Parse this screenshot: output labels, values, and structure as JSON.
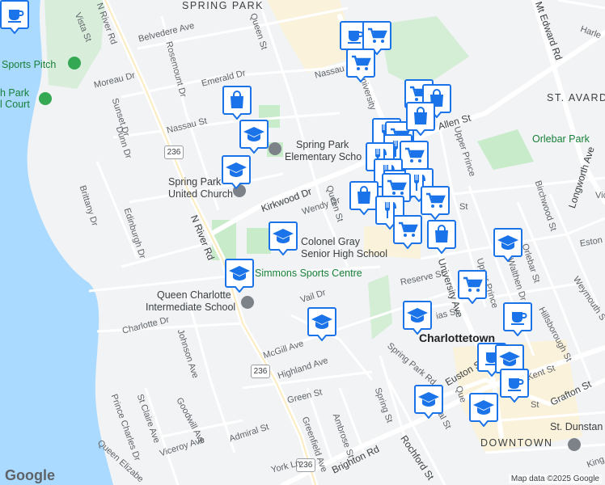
{
  "areas": {
    "spring_park": "SPRING PARK",
    "st_avard": "ST. AVARD",
    "downtown": "DOWNTOWN",
    "charlottetown": "Charlottetown"
  },
  "pois": {
    "sports_pitch": "Sports Pitch",
    "north_park_court_line1": "h Park",
    "north_park_court_line2": "l Court",
    "spring_park_school_line1": "Spring Park",
    "spring_park_school_line2": "Elementary Scho",
    "spring_park_church_line1": "Spring Park",
    "spring_park_church_line2": "United Church",
    "colonel_gray_line1": "Colonel Gray",
    "colonel_gray_line2": "Senior High School",
    "simmons": "Simmons Sports Centre",
    "queen_charlotte_line1": "Queen Charlotte",
    "queen_charlotte_line2": "Intermediate School",
    "orlebar_park": "Orlebar Park",
    "st_dunstan": "St. Dunstan"
  },
  "streets": {
    "n_river_rd_top": "N River Rd",
    "n_river_rd": "N River Rd",
    "vista": "Vista St",
    "belvedere": "Belvedere Ave",
    "queen_st_top": "Queen St",
    "rosemount": "Rosemount Dr",
    "emerald": "Emerald Dr",
    "nassau_top": "Nassau St",
    "nassau": "Nassau St",
    "moreau": "Moreau Dr",
    "sunset": "Sunset Dr",
    "dunn": "Dunn Dr",
    "university_top": "University",
    "allen": "Allen St",
    "upper_prince": "Upper Prince",
    "upper_prince_2": "Upper Prince",
    "kirkwood": "Kirkwood Dr",
    "brittany": "Brittany Dr",
    "edinburgh": "Edinburgh Dr",
    "wendy": "Wendy Dr",
    "queen_st_mid": "Queen St",
    "reserve": "Reserve St",
    "university_ave": "University Ave",
    "vail": "Vail Dr",
    "charlotte_dr": "Charlotte Dr",
    "johnson": "Johnson Ave",
    "mcgill": "McGill Ave",
    "highland": "Highland Ave",
    "spring_park_rd": "Spring Park Rd",
    "euston": "Euston St",
    "euston_right": "Euston St",
    "green": "Green St",
    "st_claire": "St Claire Ave",
    "goodwill": "Goodwill Ave",
    "prince_charles": "Prince Charles Dr",
    "admiral": "Admiral St",
    "viceroy": "Viceroy Ave",
    "greenfield": "Greenfield Ave",
    "ambrose": "Ambrose St",
    "spring_st": "Spring St",
    "rochford": "Rochford St",
    "brighton": "Brighton Rd",
    "york_ln": "York Ln",
    "queen_elizabeth": "Queen Elizabe",
    "kent": "Kent St",
    "grafton": "Grafton St",
    "walthen": "Walthen Dr",
    "birchwood": "Birchwood St",
    "orlebar": "Orlebar St",
    "hillsborough": "Hillsborough St",
    "weymouth": "Weymouth S",
    "longworth": "Longworth Ave",
    "mt_edward": "Mt Edward Rd",
    "harley": "Harle",
    "esto": "Eston St",
    "vi": "Vic",
    "ias": "ias St",
    "downl": "ownal St",
    "que": "Que",
    "king": "King",
    "street_s": "St",
    "elm": "St"
  },
  "route_shields": [
    "236",
    "236",
    "236",
    "236"
  ],
  "markers": [
    {
      "type": "cafe",
      "icon": "coffee-cup-icon"
    },
    {
      "type": "grocery",
      "icon": "shopping-cart-icon"
    },
    {
      "type": "grocery",
      "icon": "shopping-cart-icon"
    },
    {
      "type": "shopping",
      "icon": "shopping-bag-icon"
    },
    {
      "type": "school",
      "icon": "graduation-cap-icon"
    },
    {
      "type": "school",
      "icon": "graduation-cap-icon"
    },
    {
      "type": "restaurant",
      "icon": "fork-knife-icon"
    },
    {
      "type": "grocery",
      "icon": "shopping-cart-icon"
    },
    {
      "type": "shopping",
      "icon": "shopping-bag-icon"
    },
    {
      "type": "grocery",
      "icon": "shopping-cart-icon"
    },
    {
      "type": "shopping",
      "icon": "shopping-bag-icon"
    },
    {
      "type": "restaurant",
      "icon": "fork-knife-icon"
    },
    {
      "type": "restaurant",
      "icon": "fork-knife-icon"
    },
    {
      "type": "grocery",
      "icon": "shopping-cart-icon"
    },
    {
      "type": "restaurant",
      "icon": "fork-knife-icon"
    },
    {
      "type": "grocery",
      "icon": "shopping-cart-icon"
    },
    {
      "type": "restaurant",
      "icon": "fork-knife-icon"
    },
    {
      "type": "shopping",
      "icon": "shopping-bag-icon"
    },
    {
      "type": "grocery",
      "icon": "shopping-cart-icon"
    },
    {
      "type": "grocery",
      "icon": "shopping-cart-icon"
    },
    {
      "type": "restaurant",
      "icon": "fork-knife-icon"
    },
    {
      "type": "grocery",
      "icon": "shopping-cart-icon"
    },
    {
      "type": "shopping",
      "icon": "shopping-bag-icon"
    },
    {
      "type": "school",
      "icon": "graduation-cap-icon"
    },
    {
      "type": "school",
      "icon": "graduation-cap-icon"
    },
    {
      "type": "school",
      "icon": "graduation-cap-icon"
    },
    {
      "type": "grocery",
      "icon": "shopping-cart-icon"
    },
    {
      "type": "cafe",
      "icon": "coffee-cup-icon"
    },
    {
      "type": "school",
      "icon": "graduation-cap-icon"
    },
    {
      "type": "school",
      "icon": "graduation-cap-icon"
    },
    {
      "type": "cafe",
      "icon": "coffee-cup-icon"
    },
    {
      "type": "school",
      "icon": "graduation-cap-icon"
    },
    {
      "type": "cafe",
      "icon": "coffee-cup-icon"
    },
    {
      "type": "school",
      "icon": "graduation-cap-icon"
    },
    {
      "type": "school",
      "icon": "graduation-cap-icon"
    },
    {
      "type": "cafe",
      "icon": "coffee-cup-icon"
    }
  ],
  "colors": {
    "water": "#aadaff",
    "land": "#f1f3f4",
    "park": "#c8ebc9",
    "marker_fill": "#1a73e8",
    "marker_bg": "#ffffff",
    "commercial": "#fdf1d3"
  },
  "logo": "Google",
  "attribution": "Map data ©2025 Google"
}
